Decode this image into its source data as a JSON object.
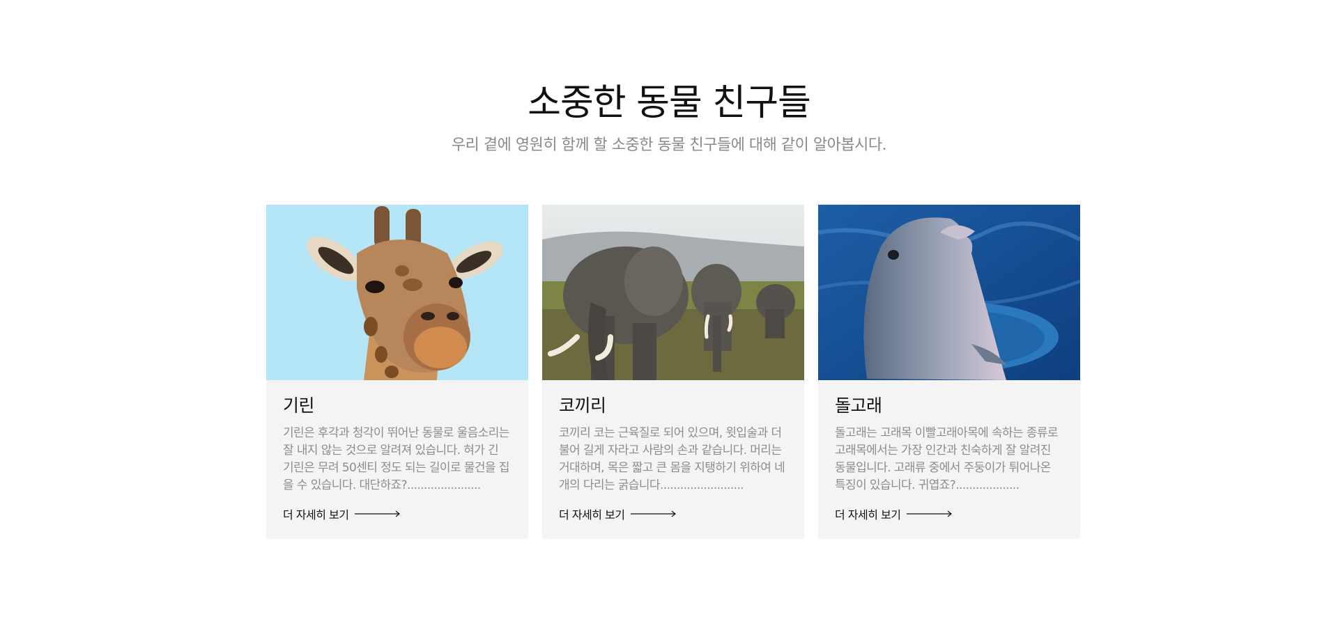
{
  "header": {
    "title": "소중한 동물 친구들",
    "subtitle": "우리 곁에 영원히 함께 할 소중한 동물 친구들에 대해 같이 알아봅시다."
  },
  "cards": [
    {
      "title": "기린",
      "description": "기린은 후각과 청각이 뛰어난 동물로 울음소리는 잘 내지 않는 것으로 알려져 있습니다. 혀가 긴 기린은 무려 50센티 정도 되는 길이로 물건을 집을 수 있습니다. 대단하죠?......................",
      "link_label": "더 자세히 보기",
      "image": "giraffe-photo"
    },
    {
      "title": "코끼리",
      "description": "코끼리 코는 근육질로 되어 있으며, 윗입술과 더불어 길게 자라고 사람의 손과 같습니다. 머리는 거대하며, 목은 짧고 큰 몸을 지탱하기 위하여 네 개의 다리는 굵습니다.........................",
      "link_label": "더 자세히 보기",
      "image": "elephant-photo"
    },
    {
      "title": "돌고래",
      "description": "돌고래는 고래목 이빨고래아목에 속하는 종류로 고래목에서는 가장 인간과 친숙하게 잘 알려진 동물입니다. 고래류 중에서 주둥이가 튀어나온 특징이 있습니다. 귀엽죠?...................",
      "link_label": "더 자세히 보기",
      "image": "dolphin-photo"
    }
  ]
}
